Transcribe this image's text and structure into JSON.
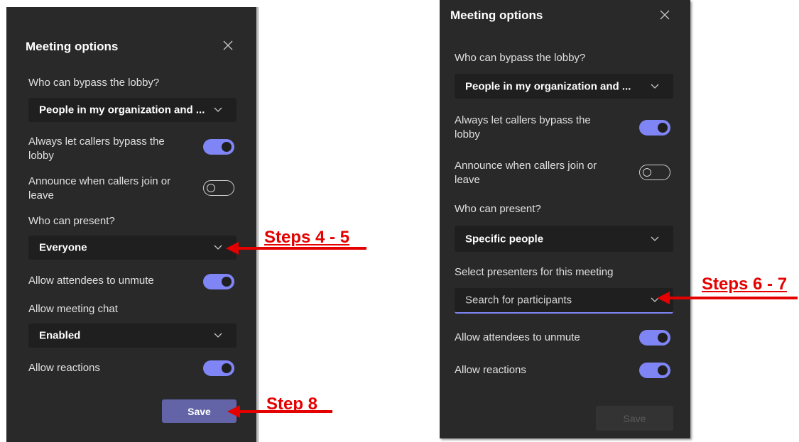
{
  "left_panel": {
    "title": "Meeting options",
    "lobby_label": "Who can bypass the lobby?",
    "lobby_value": "People in my organization and ...",
    "callers_bypass_label": "Always let callers bypass the lobby",
    "callers_bypass_on": true,
    "announce_label": "Announce when callers join or leave",
    "announce_on": false,
    "present_label": "Who can present?",
    "present_value": "Everyone",
    "unmute_label": "Allow attendees to unmute",
    "unmute_on": true,
    "chat_label": "Allow meeting chat",
    "chat_value": "Enabled",
    "reactions_label": "Allow reactions",
    "reactions_on": true,
    "save_label": "Save"
  },
  "right_panel": {
    "title": "Meeting options",
    "lobby_label": "Who can bypass the lobby?",
    "lobby_value": "People in my organization and ...",
    "callers_bypass_label": "Always let callers bypass the lobby",
    "callers_bypass_on": true,
    "announce_label": "Announce when callers join or leave",
    "announce_on": false,
    "present_label": "Who can present?",
    "present_value": "Specific people",
    "presenters_label": "Select presenters for this meeting",
    "presenters_placeholder": "Search for participants",
    "unmute_label": "Allow attendees to unmute",
    "unmute_on": true,
    "reactions_label": "Allow reactions",
    "reactions_on": true,
    "save_label": "Save"
  },
  "annotations": {
    "steps_4_5": "Steps 4 - 5",
    "steps_6_7": "Steps 6 - 7",
    "step_8": "Step 8"
  },
  "colors": {
    "panel_bg": "#292929",
    "field_bg": "#1f1f1f",
    "accent": "#7f85f5",
    "save_button": "#6264a7",
    "annotation": "#e50000"
  },
  "icons": {
    "close": "close-icon",
    "dropdown": "chevron-down-icon",
    "arrow": "arrow-left-icon"
  }
}
